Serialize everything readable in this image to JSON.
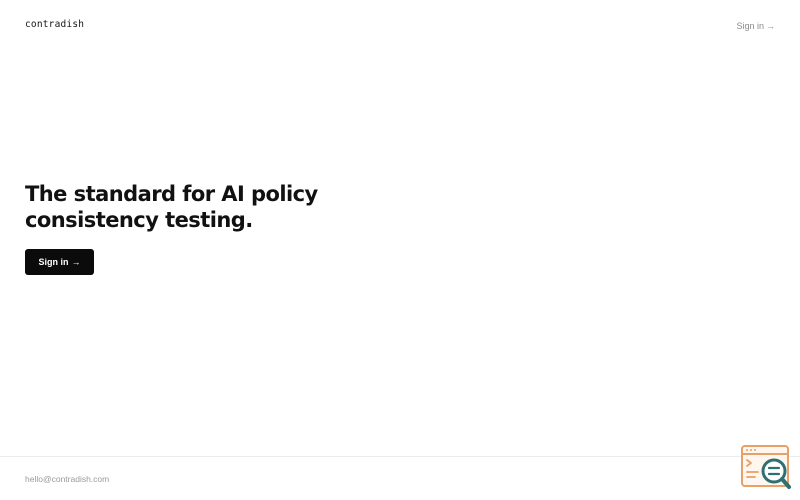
{
  "header": {
    "logo_text": "contradish",
    "signin_label": "Sign in",
    "signin_arrow": "→"
  },
  "hero": {
    "title_line1": "The standard for AI policy",
    "title_line2": "consistency testing.",
    "cta_label": "Sign in",
    "cta_arrow": "→"
  },
  "footer": {
    "email": "hello@contradish.com"
  },
  "widget": {
    "icon": "search-console-icon",
    "colors": {
      "orange": "#e8a066",
      "teal": "#2f6f73"
    }
  },
  "colors": {
    "background": "#ffffff",
    "text": "#111111",
    "muted": "#8a8a8a",
    "button_bg": "#0b0b0b",
    "button_text": "#ffffff"
  }
}
